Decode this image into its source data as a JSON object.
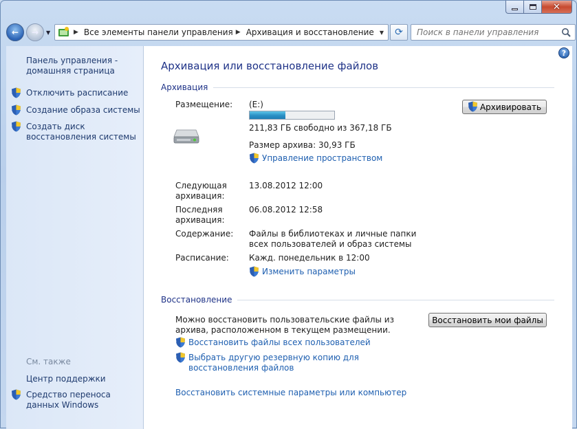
{
  "window": {
    "caption_buttons": {
      "minimize": "minimize",
      "maximize": "maximize",
      "close": "close"
    }
  },
  "nav": {
    "breadcrumb": [
      "Все элементы панели управления",
      "Архивация и восстановление"
    ],
    "search_placeholder": "Поиск в панели управления"
  },
  "sidebar": {
    "home_link": "Панель управления - домашняя страница",
    "items": [
      {
        "label": "Отключить расписание",
        "icon": "shield-icon"
      },
      {
        "label": "Создание образа системы",
        "icon": "shield-icon"
      },
      {
        "label": "Создать диск восстановления системы",
        "icon": "shield-icon"
      }
    ],
    "see_also_label": "См. также",
    "see_also": [
      {
        "label": "Центр поддержки"
      },
      {
        "label": "Средство переноса данных Windows",
        "icon": "shield-icon"
      }
    ]
  },
  "main": {
    "title": "Архивация или восстановление файлов",
    "backup": {
      "section_title": "Архивация",
      "location_label": "Размещение:",
      "drive": "(E:)",
      "used_fraction": 0.42,
      "free_space": "211,83 ГБ свободно из 367,18 ГБ",
      "archive_size": "Размер архива: 30,93 ГБ",
      "manage_space_link": "Управление пространством",
      "backup_button": "Архивировать",
      "next_label": "Следующая архивация:",
      "next_value": "13.08.2012 12:00",
      "last_label": "Последняя архивация:",
      "last_value": "06.08.2012 12:58",
      "contents_label": "Содержание:",
      "contents_value": "Файлы в библиотеках и личные папки всех пользователей и образ системы",
      "schedule_label": "Расписание:",
      "schedule_value": "Кажд. понедельник в 12:00",
      "change_settings_link": "Изменить параметры"
    },
    "restore": {
      "section_title": "Восстановление",
      "description": "Можно восстановить пользовательские файлы из архива, расположенном в текущем размещении.",
      "restore_button": "Восстановить мои файлы",
      "restore_all_link": "Восстановить файлы всех пользователей",
      "other_backup_link": "Выбрать другую резервную копию для восстановления файлов",
      "system_restore_link": "Восстановить системные параметры или компьютер"
    }
  }
}
